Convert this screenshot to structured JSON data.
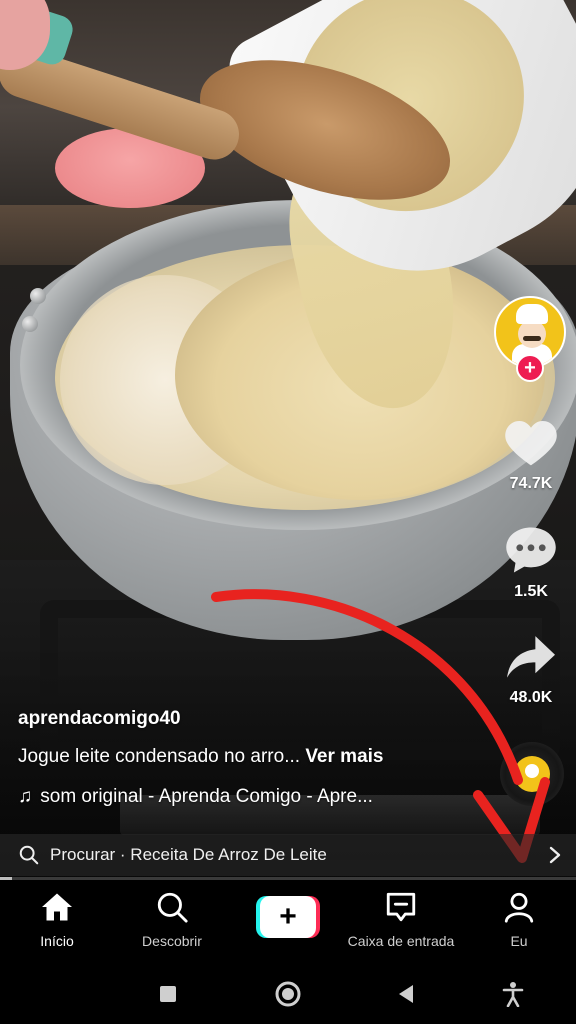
{
  "video": {
    "creator_username": "aprendacomigo40",
    "caption_text": "Jogue leite condensado no arro...",
    "caption_more": "Ver mais",
    "sound_text": "som original - Aprenda Comigo - Apre..."
  },
  "actions": {
    "likes": "74.7K",
    "comments": "1.5K",
    "shares": "48.0K",
    "follow_symbol": "+"
  },
  "search_suggestion": {
    "text": "Procurar · Receita De Arroz De Leite"
  },
  "playback": {
    "progress_fraction": 0.02
  },
  "bottom_nav": {
    "items": [
      {
        "label": "Início",
        "icon": "home-icon",
        "active": true
      },
      {
        "label": "Descobrir",
        "icon": "search-icon",
        "active": false
      },
      {
        "label": "",
        "icon": "plus-icon",
        "active": false
      },
      {
        "label": "Caixa de entrada",
        "icon": "inbox-icon",
        "active": false
      },
      {
        "label": "Eu",
        "icon": "profile-icon",
        "active": false
      }
    ]
  },
  "colors": {
    "follow_red": "#ee1d52",
    "tiktok_cyan": "#25f4ee",
    "tiktok_pink": "#fe2c55",
    "annotation_arrow": "#e8231f"
  }
}
